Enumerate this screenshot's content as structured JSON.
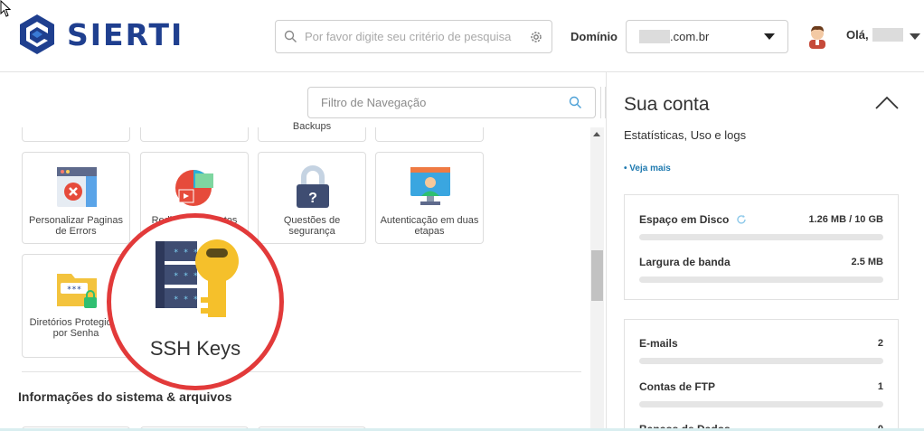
{
  "brand": {
    "name": "SIERTI",
    "color": "#1f3f8f"
  },
  "header": {
    "search_placeholder": "Por favor digite seu critério de pesquisa",
    "domain_label": "Domínio",
    "domain_value": ".com.br",
    "greeting": "Olá,"
  },
  "nav": {
    "filter_placeholder": "Filtro de Navegação",
    "partial_tile_label": "Backups",
    "tiles": [
      {
        "label": "Personalizar Paginas de Errors",
        "icon": "error-page-icon"
      },
      {
        "label": "Redirecionamentos",
        "icon": "redirect-icon"
      },
      {
        "label": "Questões de segurança",
        "icon": "security-lock-icon"
      },
      {
        "label": "Autenticação em duas etapas",
        "icon": "two-factor-icon"
      },
      {
        "label": "Diretórios Protegidos por Senha",
        "icon": "protected-folder-icon"
      }
    ],
    "section_title": "Informações do sistema & arquivos"
  },
  "highlight": {
    "label": "SSH Keys",
    "icon": "ssh-keys-icon",
    "ring_color": "#e23a3a"
  },
  "account": {
    "title": "Sua conta",
    "subtitle": "Estatísticas, Uso e logs",
    "see_more": "• Veja mais",
    "stats_group1": [
      {
        "name": "Espaço em Disco",
        "value": "1.26 MB / 10 GB",
        "fraction": 0.0001
      },
      {
        "name": "Largura de banda",
        "value": "2.5 MB",
        "fraction": 0
      }
    ],
    "stats_group2": [
      {
        "name": "E-mails",
        "value": "2",
        "fraction": 0
      },
      {
        "name": "Contas de FTP",
        "value": "1",
        "fraction": 0
      },
      {
        "name": "Bancos de Dados",
        "value": "0",
        "fraction": 0
      }
    ]
  },
  "colors": {
    "accent": "#1f7ab0",
    "search_icon": "#4a9fd6"
  }
}
